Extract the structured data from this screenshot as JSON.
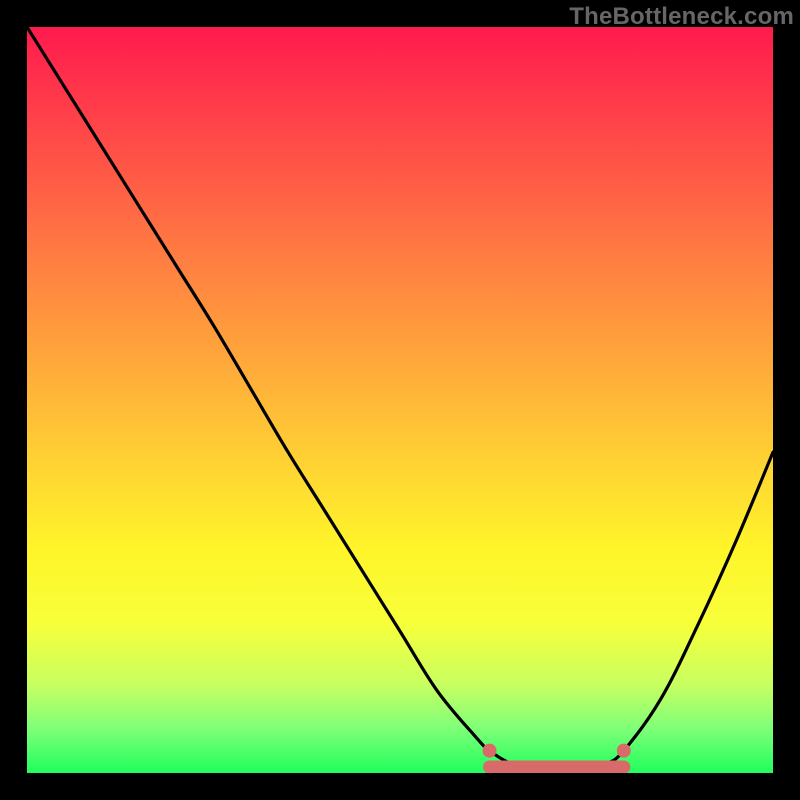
{
  "watermark": "TheBottleneck.com",
  "colors": {
    "frame": "#000000",
    "curve_stroke": "#000000",
    "marker_fill": "#d86a6a"
  },
  "chart_data": {
    "type": "line",
    "title": "",
    "xlabel": "",
    "ylabel": "",
    "xlim": [
      0,
      100
    ],
    "ylim": [
      0,
      100
    ],
    "grid": false,
    "series": [
      {
        "name": "bottleneck-curve",
        "x": [
          0,
          5,
          10,
          15,
          20,
          25,
          30,
          35,
          40,
          45,
          50,
          55,
          60,
          62,
          65,
          67.5,
          70,
          72.5,
          75,
          77.5,
          80,
          85,
          90,
          95,
          100
        ],
        "y": [
          100,
          92,
          84,
          76,
          68,
          60,
          51.5,
          43,
          35,
          27,
          19,
          11,
          5,
          3,
          1.2,
          0.7,
          0.5,
          0.5,
          0.7,
          1.2,
          3,
          10,
          20,
          31,
          43
        ]
      }
    ],
    "markers": [
      {
        "name": "fit-start",
        "x": 62,
        "y": 3
      },
      {
        "name": "fit-end",
        "x": 80,
        "y": 3
      }
    ],
    "marker_band": {
      "x_start": 62,
      "x_end": 80,
      "y": 0.8
    }
  }
}
